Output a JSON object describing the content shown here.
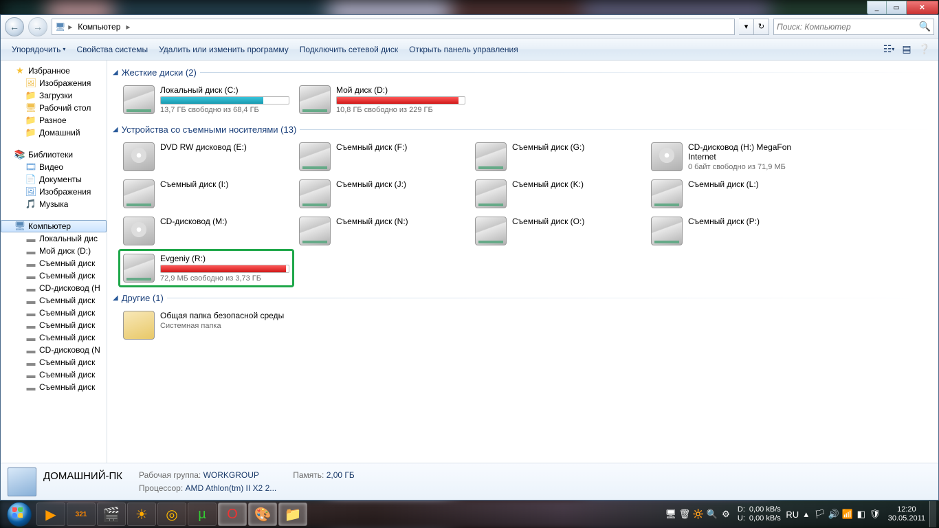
{
  "window_controls": {
    "min": "_",
    "max": "▭",
    "close": "✕"
  },
  "nav": {
    "breadcrumb_root": "Компьютер",
    "crumb_sep": "▸",
    "dropdown": "▾",
    "refresh": "↻"
  },
  "search": {
    "placeholder": "Поиск: Компьютер",
    "icon": "🔍"
  },
  "toolbar": {
    "organize": "Упорядочить",
    "organize_dd": "▾",
    "sys_props": "Свойства системы",
    "uninstall": "Удалить или изменить программу",
    "map_drive": "Подключить сетевой диск",
    "ctrl_panel": "Открыть панель управления",
    "view_dd": "▾"
  },
  "tree": {
    "favorites": "Избранное",
    "fav_items": [
      "Изображения",
      "Загрузки",
      "Рабочий стол",
      "Разное",
      "Домашний"
    ],
    "libraries": "Библиотеки",
    "lib_items": [
      "Видео",
      "Документы",
      "Изображения",
      "Музыка"
    ],
    "computer": "Компьютер",
    "comp_items": [
      "Локальный дис",
      "Мой диск (D:)",
      "Съемный диск",
      "Съемный диск",
      "CD-дисковод (H",
      "Съемный диск",
      "Съемный диск",
      "Съемный диск",
      "Съемный диск",
      "CD-дисковод (N",
      "Съемный диск",
      "Съемный диск",
      "Съемный диск"
    ]
  },
  "groups": {
    "hdd": "Жесткие диски (2)",
    "removable": "Устройства со съемными носителями (13)",
    "other": "Другие (1)"
  },
  "drives": {
    "hdd": [
      {
        "name": "Локальный диск (C:)",
        "sub": "13,7 ГБ свободно из 68,4 ГБ",
        "fill": 80,
        "color": "teal"
      },
      {
        "name": "Мой диск (D:)",
        "sub": "10,8 ГБ свободно из 229 ГБ",
        "fill": 95,
        "color": "red"
      }
    ],
    "removable_row1": [
      {
        "name": "DVD RW дисковод (E:)",
        "sub": "",
        "icon": "dvd"
      },
      {
        "name": "Съемный диск (F:)",
        "sub": "",
        "icon": "hdd"
      },
      {
        "name": "Съемный диск (G:)",
        "sub": "",
        "icon": "hdd"
      },
      {
        "name": "CD-дисковод (H:) MegaFon Internet",
        "sub": "0 байт свободно из 71,9 МБ",
        "icon": "dvd"
      }
    ],
    "removable_row2": [
      {
        "name": "Съемный диск (I:)",
        "sub": ""
      },
      {
        "name": "Съемный диск (J:)",
        "sub": ""
      },
      {
        "name": "Съемный диск (K:)",
        "sub": ""
      },
      {
        "name": "Съемный диск (L:)",
        "sub": ""
      }
    ],
    "removable_row3": [
      {
        "name": "CD-дисковод (M:)",
        "sub": "",
        "icon": "dvd"
      },
      {
        "name": "Съемный диск (N:)",
        "sub": ""
      },
      {
        "name": "Съемный диск (O:)",
        "sub": ""
      },
      {
        "name": "Съемный диск (P:)",
        "sub": ""
      }
    ],
    "removable_row4": [
      {
        "name": "Evgeniy (R:)",
        "sub": "72,9 МБ свободно из 3,73 ГБ",
        "fill": 98,
        "color": "red",
        "highlight": true
      }
    ],
    "other": [
      {
        "name": "Общая папка безопасной среды",
        "sub": "Системная папка",
        "icon": "fld"
      }
    ]
  },
  "details": {
    "title": "ДОМАШНИЙ-ПК",
    "workgroup_lbl": "Рабочая группа:",
    "workgroup": "WORKGROUP",
    "cpu_lbl": "Процессор:",
    "cpu": "AMD Athlon(tm) II X2 2...",
    "mem_lbl": "Память:",
    "mem": "2,00 ГБ"
  },
  "tray": {
    "net_d_lbl": "D:",
    "net_d": "0,00 kB/s",
    "net_u_lbl": "U:",
    "net_u": "0,00 kB/s",
    "lang": "RU",
    "time": "12:20",
    "date": "30.05.2011"
  }
}
